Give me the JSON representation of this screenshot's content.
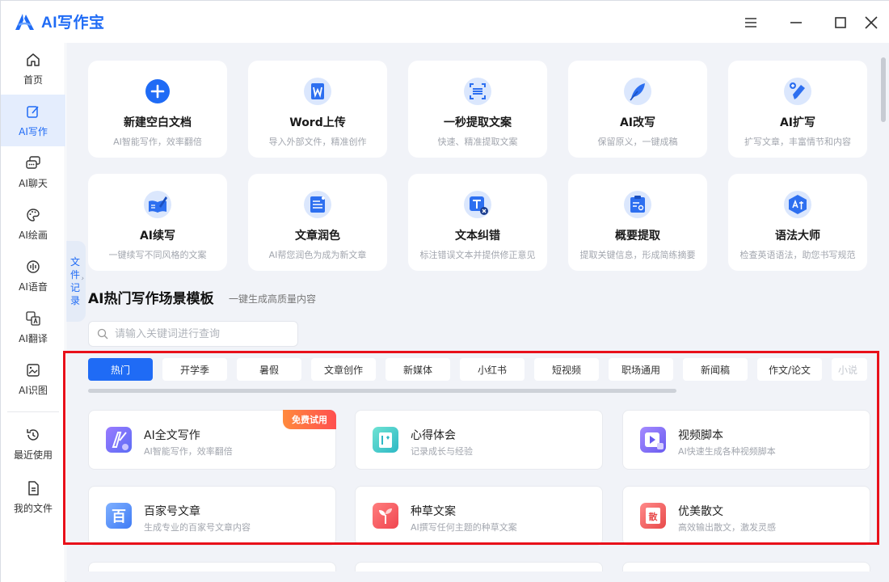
{
  "app": {
    "name": "AI写作宝"
  },
  "colors": {
    "accent": "#1f6bf5",
    "badge": "#ff5a4a",
    "highlight_frame": "#e8101a"
  },
  "window_controls": [
    "menu-icon",
    "minimize-icon",
    "maximize-icon",
    "close-icon"
  ],
  "sidebar": {
    "items": [
      {
        "label": "首页",
        "icon": "home-icon"
      },
      {
        "label": "AI写作",
        "icon": "edit-icon",
        "active": true
      },
      {
        "label": "AI聊天",
        "icon": "chat-icon"
      },
      {
        "label": "AI绘画",
        "icon": "palette-icon"
      },
      {
        "label": "AI语音",
        "icon": "voice-icon"
      },
      {
        "label": "AI翻译",
        "icon": "translate-icon"
      },
      {
        "label": "AI识图",
        "icon": "image-icon"
      },
      {
        "label": "最近使用",
        "icon": "history-icon"
      },
      {
        "label": "我的文件",
        "icon": "file-icon"
      }
    ]
  },
  "tools": [
    {
      "title": "新建空白文档",
      "subtitle": "AI智能写作，效率翻倍",
      "icon": "plus-icon"
    },
    {
      "title": "Word上传",
      "subtitle": "导入外部文件，精准创作",
      "icon": "word-icon"
    },
    {
      "title": "一秒提取文案",
      "subtitle": "快速、精准提取文案",
      "icon": "scan-icon"
    },
    {
      "title": "AI改写",
      "subtitle": "保留原义，一键成稿",
      "icon": "feather-icon"
    },
    {
      "title": "AI扩写",
      "subtitle": "扩写文章，丰富情节和内容",
      "icon": "pen-expand-icon"
    },
    {
      "title": "AI续写",
      "subtitle": "一键续写不同风格的文案",
      "icon": "book-pen-icon"
    },
    {
      "title": "文章润色",
      "subtitle": "AI帮您润色为成为新文章",
      "icon": "document-polish-icon"
    },
    {
      "title": "文本纠错",
      "subtitle": "标注错误文本并提供修正意见",
      "icon": "text-correct-icon"
    },
    {
      "title": "概要提取",
      "subtitle": "提取关键信息，形成简练摘要",
      "icon": "clipboard-search-icon"
    },
    {
      "title": "语法大师",
      "subtitle": "检查英语语法，助您书写规范",
      "icon": "grammar-icon"
    }
  ],
  "side_tab": {
    "chars": [
      "文",
      "件",
      "记",
      "录"
    ]
  },
  "templates_section": {
    "title": "AI热门写作场景模板",
    "subtitle": "一键生成高质量内容",
    "search_placeholder": "请输入关键词进行查询"
  },
  "category_tabs": [
    "热门",
    "开学季",
    "暑假",
    "文章创作",
    "新媒体",
    "小红书",
    "短视频",
    "职场通用",
    "新闻稿",
    "作文/论文",
    "小说"
  ],
  "templates": [
    {
      "title": "AI全文写作",
      "subtitle": "AI智能写作，效率翻倍",
      "icon": "ai-writing-icon",
      "badge": "免费试用"
    },
    {
      "title": "心得体会",
      "subtitle": "记录成长与经验",
      "icon": "notebook-icon"
    },
    {
      "title": "视频脚本",
      "subtitle": "AI快速生成各种视频脚本",
      "icon": "video-icon"
    },
    {
      "title": "百家号文章",
      "subtitle": "生成专业的百家号文章内容",
      "icon": "baijiahao-icon",
      "icon_char": "百"
    },
    {
      "title": "种草文案",
      "subtitle": "AI撰写任何主题的种草文案",
      "icon": "sprout-icon"
    },
    {
      "title": "优美散文",
      "subtitle": "高效输出散文，激发灵感",
      "icon": "prose-book-icon",
      "icon_char": "散"
    }
  ]
}
